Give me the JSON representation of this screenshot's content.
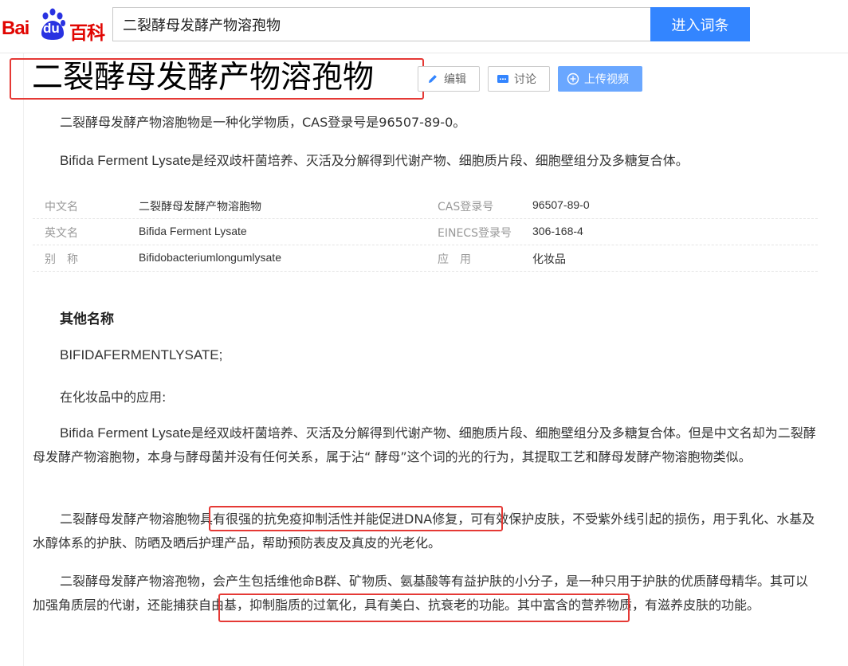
{
  "header": {
    "logo_bai": "Bai",
    "logo_du": "du",
    "logo_baike": "百科",
    "search_value": "二裂酵母发酵产物溶孢物",
    "search_button": "进入词条"
  },
  "entry": {
    "title": "二裂酵母发酵产物溶孢物",
    "edit_label": "编辑",
    "discuss_label": "讨论",
    "upload_label": "上传视频"
  },
  "intro": {
    "p1": "二裂酵母发酵产物溶胞物是一种化学物质，CAS登录号是96507-89-0。",
    "p2_en": "Bifida Ferment Lysate",
    "p2_rest": "是经双歧杆菌培养、灭活及分解得到代谢产物、细胞质片段、细胞壁组分及多糖复合体。"
  },
  "info_table": [
    {
      "l1": "中文名",
      "v1": "二裂酵母发酵产物溶胞物",
      "l2": "CAS登录号",
      "v2": "96507-89-0"
    },
    {
      "l1": "英文名",
      "v1": "Bifida Ferment Lysate",
      "l2": "EINECS登录号",
      "v2": "306-168-4"
    },
    {
      "l1": "别　称",
      "v1": "Bifidobacteriumlongumlysate",
      "l2": "应　用",
      "v2": "化妆品"
    }
  ],
  "other_names": {
    "title": "其他名称",
    "value": "BIFIDAFERMENTLYSATE;"
  },
  "cosmetics": {
    "heading": "在化妆品中的应用:",
    "p1_en": "Bifida Ferment Lysate",
    "p1_rest": "是经双歧杆菌培养、灭活及分解得到代谢产物、细胞质片段、细胞壁组分及多糖复合体。但是中文名却为二裂酵母发酵产物溶胞物，本身与酵母菌并没有任何关系，属于沾“ 酵母”这个词的光的行为，其提取工艺和酵母发酵产物溶胞物类似。",
    "p2": "二裂酵母发酵产物溶胞物具有很强的抗免疫抑制活性并能促进DNA修复，可有效保护皮肤，不受紫外线引起的损伤，用于乳化、水基及水醇体系的护肤、防晒及晒后护理产品，帮助预防表皮及真皮的光老化。",
    "p3": "二裂酵母发酵产物溶孢物，会产生包括维他命B群、矿物质、氨基酸等有益护肤的小分子，是一种只用于护肤的优质酵母精华。其可以加强角质层的代谢，还能捕获自由基，抑制脂质的过氧化，具有美白、抗衰老的功能。其中富含的营养物质，有滋养皮肤的功能。"
  },
  "colors": {
    "brand_red": "#e10602",
    "brand_blue": "#2932e1",
    "button_blue": "#3385ff",
    "highlight_red": "#e53935"
  }
}
